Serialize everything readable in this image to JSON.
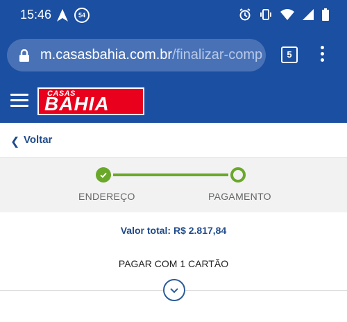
{
  "status_bar": {
    "time": "15:46",
    "notification_count": "54"
  },
  "browser": {
    "url_domain": "m.casasbahia.com.br",
    "url_path": "/finalizar-comp",
    "tab_count": "5"
  },
  "header": {
    "logo_small": "CASAS",
    "logo_big": "BAHIA"
  },
  "back": {
    "label": "Voltar"
  },
  "steps": [
    {
      "label": "ENDEREÇO",
      "state": "done"
    },
    {
      "label": "PAGAMENTO",
      "state": "current"
    }
  ],
  "summary": {
    "total": "Valor total: R$ 2.817,84",
    "payment_option": "PAGAR COM 1 CARTÃO"
  },
  "colors": {
    "brand_blue": "#1b4fa1",
    "logo_red": "#e8001c",
    "step_green": "#6aa82a",
    "text_blue": "#1f4a8a"
  }
}
